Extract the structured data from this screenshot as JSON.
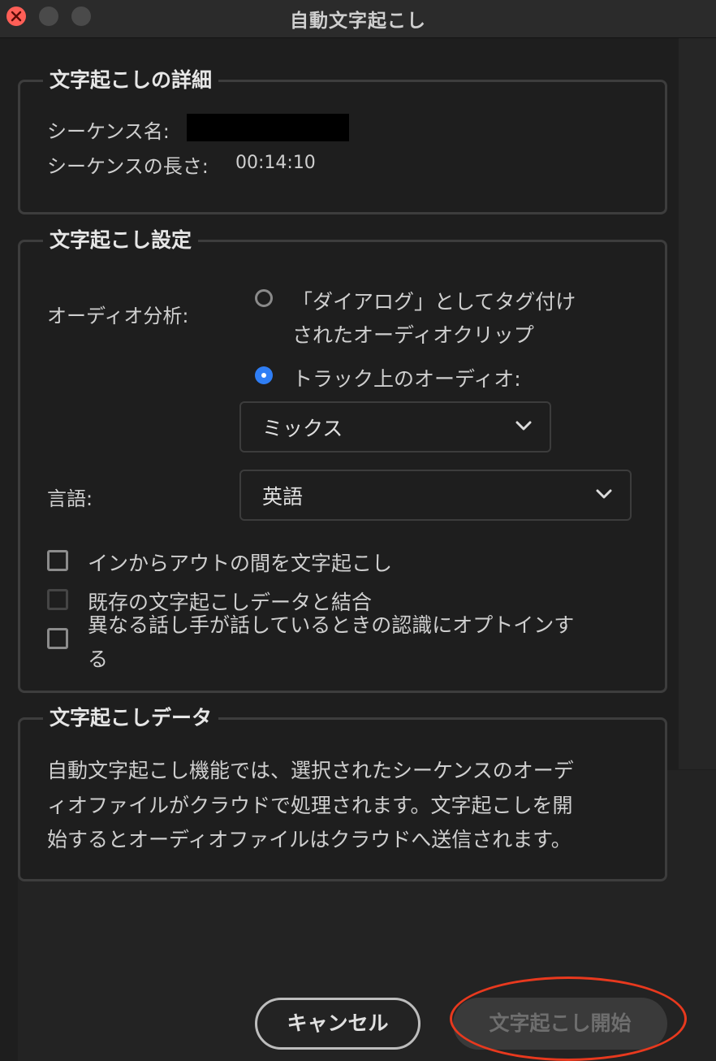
{
  "window": {
    "title": "自動文字起こし"
  },
  "details": {
    "legend": "文字起こしの詳細",
    "sequence_name_label": "シーケンス名:",
    "sequence_length_label": "シーケンスの長さ:",
    "sequence_length_value": "00:14:10"
  },
  "settings": {
    "legend": "文字起こし設定",
    "audio_analysis_label": "オーディオ分析:",
    "radio_dialogue_line1": "「ダイアログ」としてタグ付け",
    "radio_dialogue_line2": "されたオーディオクリップ",
    "radio_track": "トラック上のオーディオ:",
    "track_dropdown_value": "ミックス",
    "language_label": "言語:",
    "language_dropdown_value": "英語",
    "checkbox_in_out": "インからアウトの間を文字起こし",
    "checkbox_merge": "既存の文字起こしデータと結合",
    "checkbox_speakers_line1": "異なる話し手が話しているときの認識にオプトインす",
    "checkbox_speakers_line2": "る"
  },
  "data_section": {
    "legend": "文字起こしデータ",
    "line1": "自動文字起こし機能では、選択されたシーケンスのオーデ",
    "line2": "ィオファイルがクラウドで処理されます。文字起こしを開",
    "line3": "始するとオーディオファイルはクラウドへ送信されます。"
  },
  "buttons": {
    "cancel": "キャンセル",
    "start": "文字起こし開始"
  },
  "colors": {
    "accent_radio": "#2f7ef5",
    "highlight_ring": "#e8391e",
    "close_button": "#ff5f57"
  }
}
